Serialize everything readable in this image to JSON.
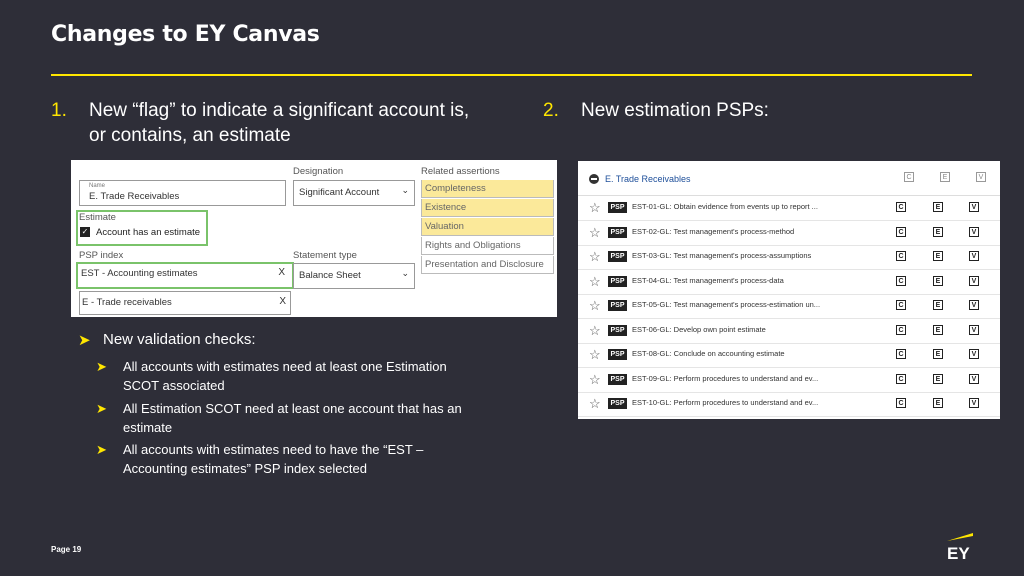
{
  "title": "Changes to EY Canvas",
  "point1": {
    "num": "1.",
    "line1": "New “flag” to indicate a significant account is,",
    "line2": "or contains, an estimate"
  },
  "point2": {
    "num": "2.",
    "line1": "New estimation PSPs:"
  },
  "form": {
    "name_label": "Name",
    "name_value": "E. Trade Receivables",
    "estimate_label": "Estimate",
    "checkbox_label": "Account has an estimate",
    "psp_label": "PSP index",
    "psp_value1": "EST - Accounting estimates",
    "psp_value2": "E - Trade receivables",
    "clear_icon": "X",
    "designation_label": "Designation",
    "designation_value": "Significant Account",
    "statement_label": "Statement type",
    "statement_value": "Balance Sheet",
    "assertions_label": "Related assertions",
    "assertions": [
      "Completeness",
      "Existence",
      "Valuation",
      "Rights and Obligations",
      "Presentation and Disclosure"
    ]
  },
  "validation": {
    "heading": "New validation checks:",
    "items": [
      {
        "l1": "All accounts with estimates need at least one Estimation",
        "l2": "SCOT associated"
      },
      {
        "l1": "All Estimation SCOT need at least one account that has an",
        "l2": "estimate"
      },
      {
        "l1": "All accounts with estimates need to have the “EST –",
        "l2": "Accounting estimates” PSP index selected"
      }
    ]
  },
  "psp_panel": {
    "header": "E. Trade Receivables",
    "col_c": "C",
    "col_e": "E",
    "col_v": "V",
    "badge": "PSP",
    "rows": [
      "EST-01-GL: Obtain evidence from events up to report ...",
      "EST-02-GL: Test management's process-method",
      "EST-03-GL: Test management's process-assumptions",
      "EST-04-GL: Test management's process-data",
      "EST-05-GL: Test management's process-estimation un...",
      "EST-06-GL: Develop own point estimate",
      "EST-08-GL: Conclude on accounting estimate",
      "EST-09-GL: Perform procedures to understand and ev...",
      "EST-10-GL: Perform procedures to understand and ev..."
    ]
  },
  "footer": {
    "page": "Page 19",
    "logo": "EY"
  },
  "colors": {
    "accent": "#ffe600",
    "background": "#2e2e38",
    "highlight": "#fbe99a",
    "green": "#7ac36a"
  }
}
